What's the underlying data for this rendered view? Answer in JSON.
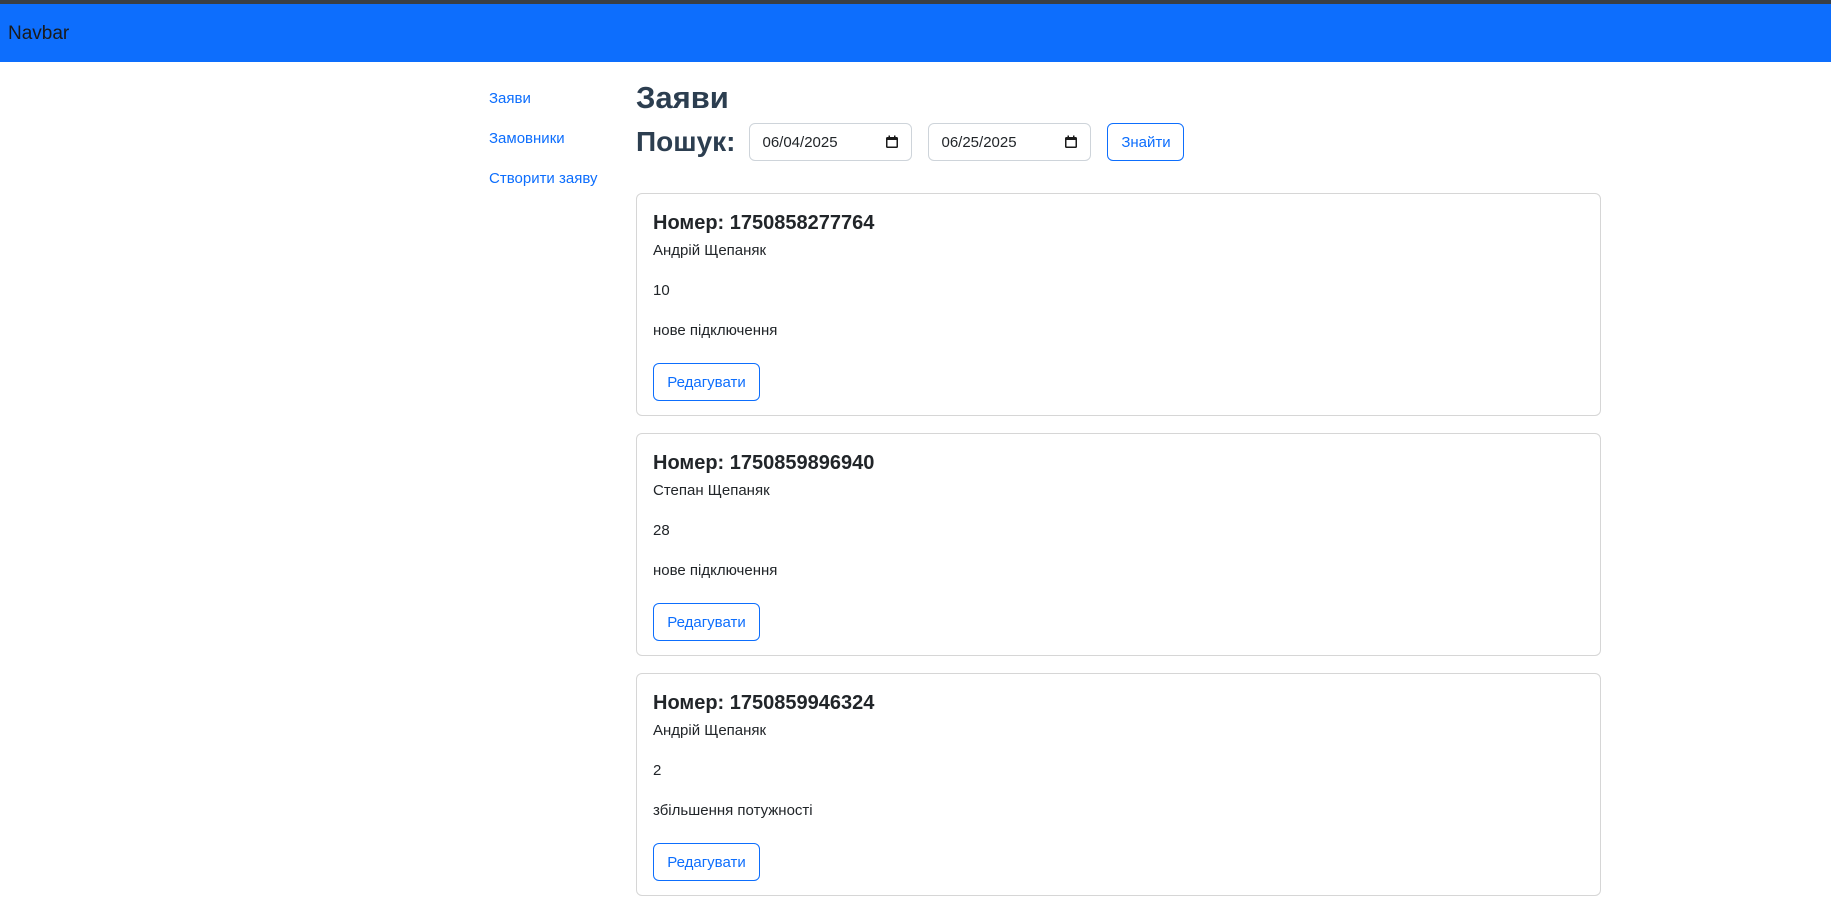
{
  "navbar": {
    "brand": "Navbar"
  },
  "sidebar": {
    "items": [
      {
        "label": "Заяви"
      },
      {
        "label": "Замовники"
      },
      {
        "label": "Створити заяву"
      }
    ]
  },
  "main": {
    "title": "Заяви",
    "search": {
      "label": "Пошук:",
      "date_from": "06/04/2025",
      "date_to": "06/25/2025",
      "button_label": "Знайти"
    },
    "orders": [
      {
        "number_text": "Номер: 1750858277764",
        "customer": "Андрій Щепаняк",
        "quantity": "10",
        "type": "нове підключення",
        "edit_label": "Редагувати"
      },
      {
        "number_text": "Номер: 1750859896940",
        "customer": "Степан Щепаняк",
        "quantity": "28",
        "type": "нове підключення",
        "edit_label": "Редагувати"
      },
      {
        "number_text": "Номер: 1750859946324",
        "customer": "Андрій Щепаняк",
        "quantity": "2",
        "type": "збільшення потужності",
        "edit_label": "Редагувати"
      }
    ]
  },
  "colors": {
    "primary": "#0d6efd",
    "heading": "#2c3e50",
    "border": "#d6d6d6"
  }
}
